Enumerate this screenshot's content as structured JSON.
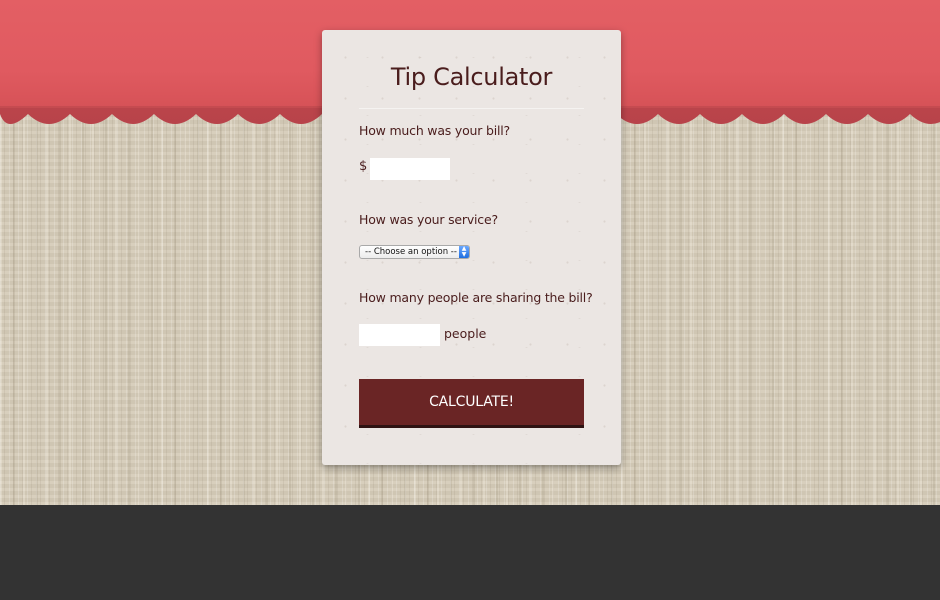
{
  "app": {
    "title": "Tip Calculator"
  },
  "form": {
    "bill": {
      "question": "How much was your bill?",
      "currency_symbol": "$",
      "value": "",
      "placeholder": ""
    },
    "service": {
      "question": "How was your service?",
      "selected_option": "-- Choose an option --"
    },
    "people": {
      "question": "How many people are sharing the bill?",
      "value": "",
      "placeholder": "",
      "suffix": "people"
    },
    "submit_label": "CALCULATE!"
  },
  "colors": {
    "awning_red": "#e05d62",
    "awning_dark": "#c54b50",
    "title_text": "#4a1d1d",
    "button_bg": "#6a2525",
    "footer_bg": "#333333",
    "card_bg": "#ebe6e3"
  },
  "icons": {
    "select_arrow": "select-arrows-icon"
  }
}
